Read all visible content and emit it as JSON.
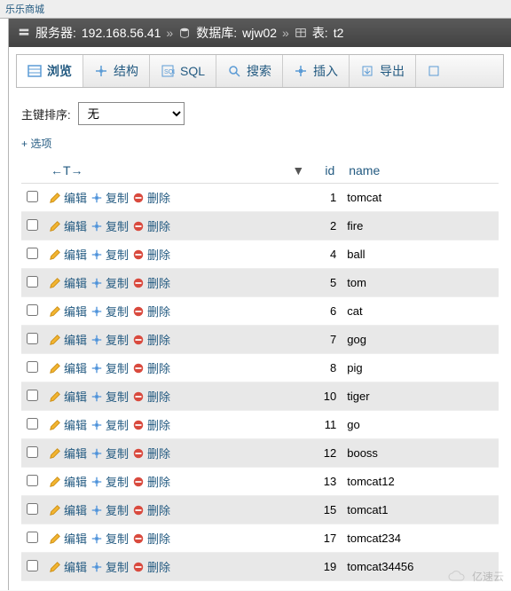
{
  "topHeader": "乐乐商城",
  "breadcrumb": {
    "serverLabel": "服务器:",
    "server": "192.168.56.41",
    "dbLabel": "数据库:",
    "db": "wjw02",
    "tableLabel": "表:",
    "table": "t2"
  },
  "tabs": {
    "browse": "浏览",
    "structure": "结构",
    "sql": "SQL",
    "search": "搜索",
    "insert": "插入",
    "export": "导出"
  },
  "sort": {
    "label": "主键排序:",
    "value": "无"
  },
  "optionsLink": "+ 选项",
  "headers": {
    "rowCtrlLeft": "←T→",
    "dropdown": "▼",
    "id": "id",
    "name": "name"
  },
  "actionLabels": {
    "edit": "编辑",
    "copy": "复制",
    "delete": "删除"
  },
  "rows": [
    {
      "id": "1",
      "name": "tomcat"
    },
    {
      "id": "2",
      "name": "fire"
    },
    {
      "id": "4",
      "name": "ball"
    },
    {
      "id": "5",
      "name": "tom"
    },
    {
      "id": "6",
      "name": "cat"
    },
    {
      "id": "7",
      "name": "gog"
    },
    {
      "id": "8",
      "name": "pig"
    },
    {
      "id": "10",
      "name": "tiger"
    },
    {
      "id": "11",
      "name": "go"
    },
    {
      "id": "12",
      "name": "booss"
    },
    {
      "id": "13",
      "name": "tomcat12"
    },
    {
      "id": "15",
      "name": "tomcat1"
    },
    {
      "id": "17",
      "name": "tomcat234"
    },
    {
      "id": "19",
      "name": "tomcat34456"
    }
  ],
  "watermark": "亿速云"
}
